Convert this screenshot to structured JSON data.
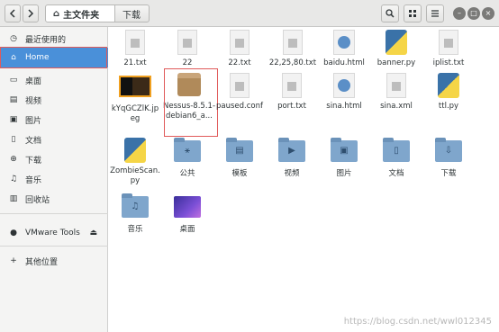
{
  "header": {
    "breadcrumbs": [
      "主文件夹",
      "下载"
    ],
    "back_icon": "chevron-left-icon",
    "forward_icon": "chevron-right-icon",
    "search_icon": "search-icon",
    "view_icon": "grid-view-icon",
    "menu_icon": "hamburger-menu-icon"
  },
  "sidebar": {
    "items": [
      {
        "label": "最近使用的",
        "icon": "clock-icon"
      },
      {
        "label": "Home",
        "icon": "home-icon"
      },
      {
        "label": "桌面",
        "icon": "desktop-icon"
      },
      {
        "label": "视频",
        "icon": "video-icon"
      },
      {
        "label": "图片",
        "icon": "image-icon"
      },
      {
        "label": "文档",
        "icon": "document-icon"
      },
      {
        "label": "下载",
        "icon": "download-icon"
      },
      {
        "label": "音乐",
        "icon": "music-icon"
      },
      {
        "label": "回收站",
        "icon": "trash-icon"
      },
      {
        "label": "VMware Tools",
        "icon": "disc-icon"
      },
      {
        "label": "其他位置",
        "icon": "plus-icon"
      }
    ],
    "selected": "Home"
  },
  "files": [
    {
      "name": "21.txt",
      "type": "text"
    },
    {
      "name": "22",
      "type": "text"
    },
    {
      "name": "22.txt",
      "type": "text"
    },
    {
      "name": "22,25,80.txt",
      "type": "text"
    },
    {
      "name": "baidu.html",
      "type": "html"
    },
    {
      "name": "banner.py",
      "type": "python"
    },
    {
      "name": "iplist.txt",
      "type": "text"
    },
    {
      "name": "kYqGCZlK.jpeg",
      "type": "image"
    },
    {
      "name": "Nessus-8.5.1-debian6_a...",
      "type": "package"
    },
    {
      "name": "paused.conf",
      "type": "text"
    },
    {
      "name": "port.txt",
      "type": "text"
    },
    {
      "name": "sina.html",
      "type": "html"
    },
    {
      "name": "sina.xml",
      "type": "text"
    },
    {
      "name": "ttl.py",
      "type": "python"
    },
    {
      "name": "ZombieScan.py",
      "type": "python"
    },
    {
      "name": "公共",
      "type": "folder"
    },
    {
      "name": "模板",
      "type": "folder"
    },
    {
      "name": "视频",
      "type": "folder"
    },
    {
      "name": "图片",
      "type": "folder"
    },
    {
      "name": "文档",
      "type": "folder"
    },
    {
      "name": "下载",
      "type": "folder"
    },
    {
      "name": "音乐",
      "type": "folder"
    },
    {
      "name": "桌面",
      "type": "desktop"
    }
  ],
  "watermark": "https://blog.csdn.net/wwl012345"
}
